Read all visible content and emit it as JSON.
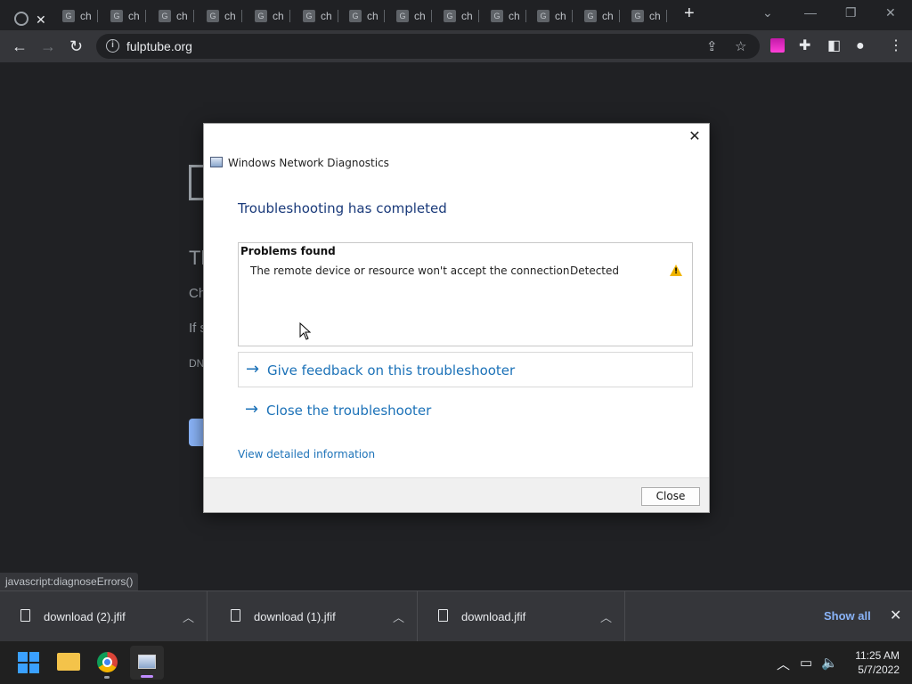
{
  "browser": {
    "active_tab_icon": "globe-icon",
    "tabs": [
      {
        "favicon": "G",
        "title": "ch"
      },
      {
        "favicon": "G",
        "title": "ch"
      },
      {
        "favicon": "G",
        "title": "ch"
      },
      {
        "favicon": "G",
        "title": "ch"
      },
      {
        "favicon": "G",
        "title": "ch"
      },
      {
        "favicon": "G",
        "title": "ch"
      },
      {
        "favicon": "G",
        "title": "ch"
      },
      {
        "favicon": "G",
        "title": "ch"
      },
      {
        "favicon": "G",
        "title": "ch"
      },
      {
        "favicon": "G",
        "title": "ch"
      },
      {
        "favicon": "G",
        "title": "ch"
      },
      {
        "favicon": "G",
        "title": "ch"
      },
      {
        "favicon": "G",
        "title": "ch"
      }
    ],
    "new_tab_label": "+",
    "url": "fulptube.org",
    "status_url": "javascript:diagnoseErrors()"
  },
  "background_page": {
    "title_fragment": "Th",
    "line1_fragment": "Ch",
    "line2_fragment": "If s",
    "code_fragment": "DN"
  },
  "dialog": {
    "window_title": "Windows Network Diagnostics",
    "heading": "Troubleshooting has completed",
    "problems_header": "Problems found",
    "problem_description": "The remote device or resource won't accept the connection",
    "problem_status": "Detected",
    "feedback_link": "Give feedback on this troubleshooter",
    "close_troubleshooter_link": "Close the troubleshooter",
    "details_link": "View detailed information",
    "close_button": "Close",
    "close_x": "✕"
  },
  "downloads": {
    "items": [
      {
        "name": "download (2).jfif"
      },
      {
        "name": "download (1).jfif"
      },
      {
        "name": "download.jfif"
      }
    ],
    "show_all": "Show all"
  },
  "taskbar": {
    "time": "11:25 AM",
    "date": "5/7/2022"
  },
  "colors": {
    "link_blue": "#1c72b8",
    "heading_blue": "#1a3a7a",
    "warning_yellow": "#f0b400",
    "chrome_dark": "#202124",
    "show_all_blue": "#8ab4f8"
  }
}
